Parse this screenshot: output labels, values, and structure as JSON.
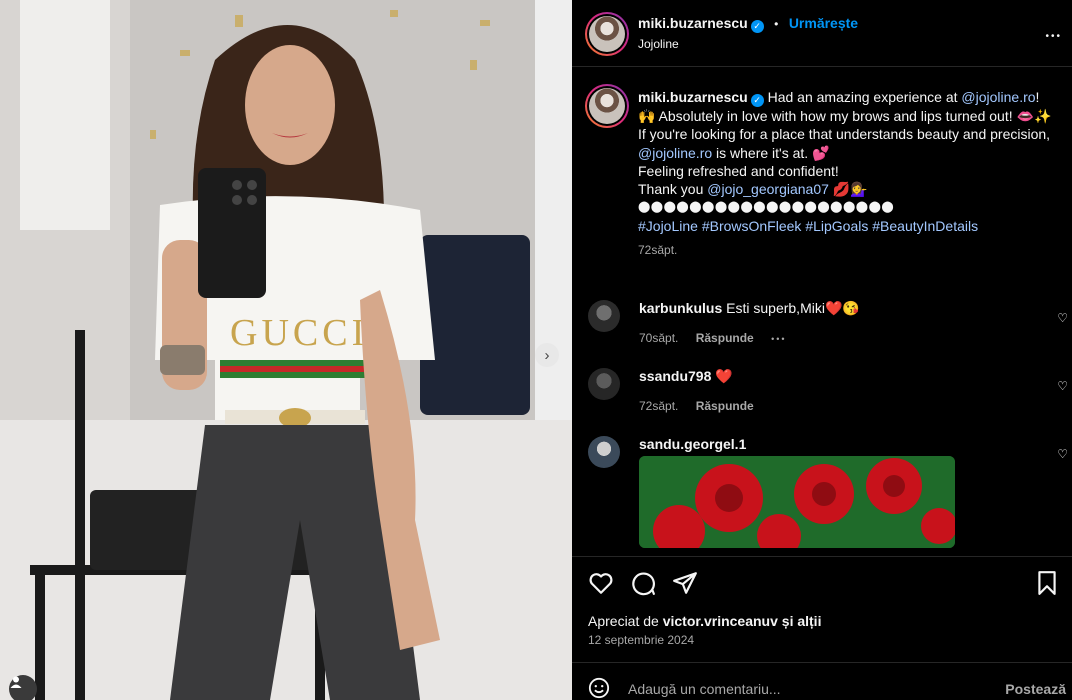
{
  "header": {
    "username": "miki.buzarnescu",
    "separator": "•",
    "follow_label": "Urmărește",
    "location": "Jojoline",
    "more": "•••"
  },
  "caption": {
    "username": "miki.buzarnescu",
    "line1a": "Had an amazing experience at",
    "mention1": "@jojoline.ro",
    "line1b": "! 🙌 Absolutely in love with how my brows and lips turned out! 👄✨",
    "line2a": "If you're looking for a place that understands beauty and precision,",
    "mention2": "@jojoline.ro",
    "line2b": "is where it's at. 💕",
    "line3": "Feeling refreshed and confident!",
    "line4a": "Thank you",
    "mention3": "@jojo_georgiana07",
    "line4b": "💋💁‍♀️",
    "dots": "⬤⬤⬤⬤⬤⬤⬤⬤⬤⬤⬤⬤⬤⬤⬤⬤⬤⬤⬤⬤",
    "hashtags": [
      "#JojoLine",
      "#BrowsOnFleek",
      "#LipGoals",
      "#BeautyInDetails"
    ],
    "time": "72săpt."
  },
  "comments": [
    {
      "username": "karbunkulus",
      "text": "Esti superb,Miki❤️😘",
      "time": "70săpt.",
      "reply": "Răspunde",
      "more": "•••"
    },
    {
      "username": "ssandu798",
      "text": "❤️",
      "time": "72săpt.",
      "reply": "Răspunde"
    },
    {
      "username": "sandu.georgel.1",
      "text": ""
    }
  ],
  "likes": {
    "prefix": "Apreciat de",
    "user": "victor.vrinceanuv",
    "suffix": "și alții"
  },
  "date": "12 septembrie 2024",
  "add_comment": {
    "placeholder": "Adaugă un comentariu...",
    "post_label": "Postează"
  },
  "colors": {
    "accent": "#0095f6",
    "link": "#a3c8ff",
    "muted": "#a8a8a8",
    "background": "#000000"
  }
}
